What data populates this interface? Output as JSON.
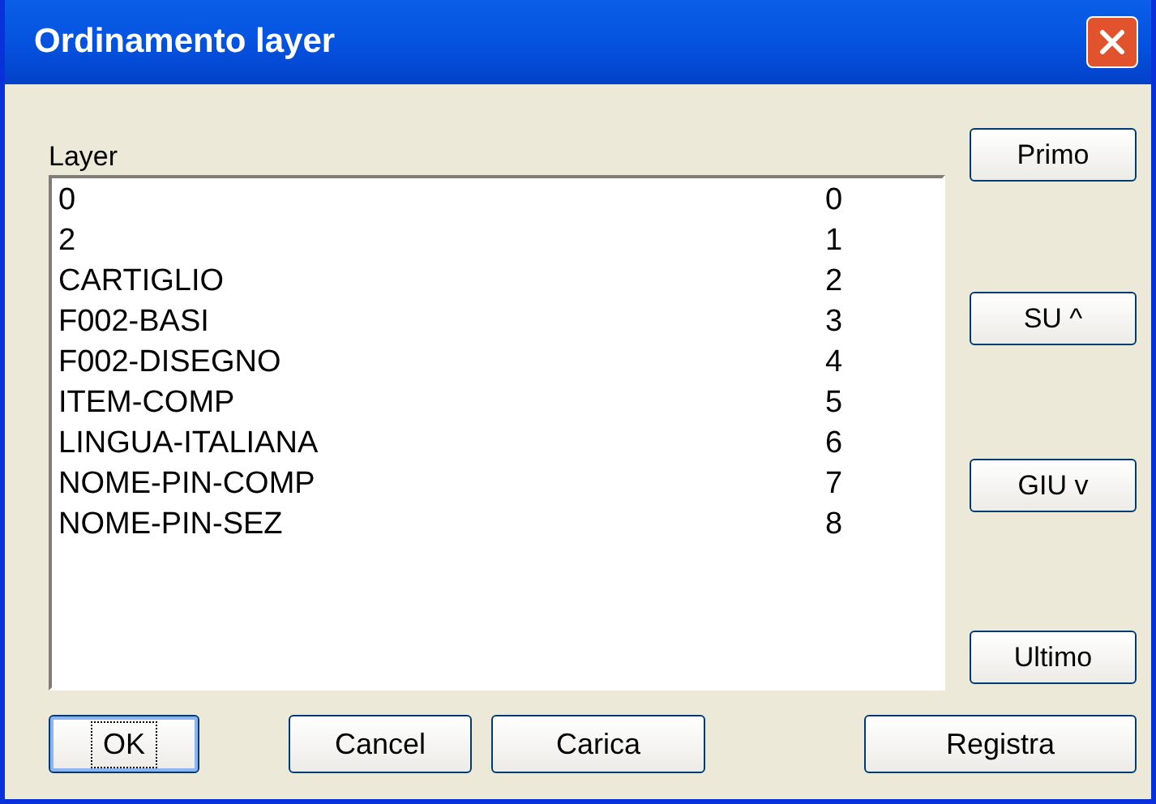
{
  "window": {
    "title": "Ordinamento layer"
  },
  "list": {
    "label": "Layer",
    "rows": [
      {
        "name": "0",
        "order": "0"
      },
      {
        "name": "2",
        "order": "1"
      },
      {
        "name": "CARTIGLIO",
        "order": "2"
      },
      {
        "name": "F002-BASI",
        "order": "3"
      },
      {
        "name": "F002-DISEGNO",
        "order": "4"
      },
      {
        "name": "ITEM-COMP",
        "order": "5"
      },
      {
        "name": "LINGUA-ITALIANA",
        "order": "6"
      },
      {
        "name": "NOME-PIN-COMP",
        "order": "7"
      },
      {
        "name": "NOME-PIN-SEZ",
        "order": "8"
      }
    ]
  },
  "side_buttons": [
    "Primo",
    "SU ^",
    "GIU v",
    "Ultimo"
  ],
  "bottom_buttons": [
    {
      "label": "OK",
      "focused": true
    },
    {
      "label": "Cancel",
      "focused": false
    },
    {
      "label": "Carica",
      "focused": false
    },
    {
      "label": "Registra",
      "focused": false
    }
  ]
}
